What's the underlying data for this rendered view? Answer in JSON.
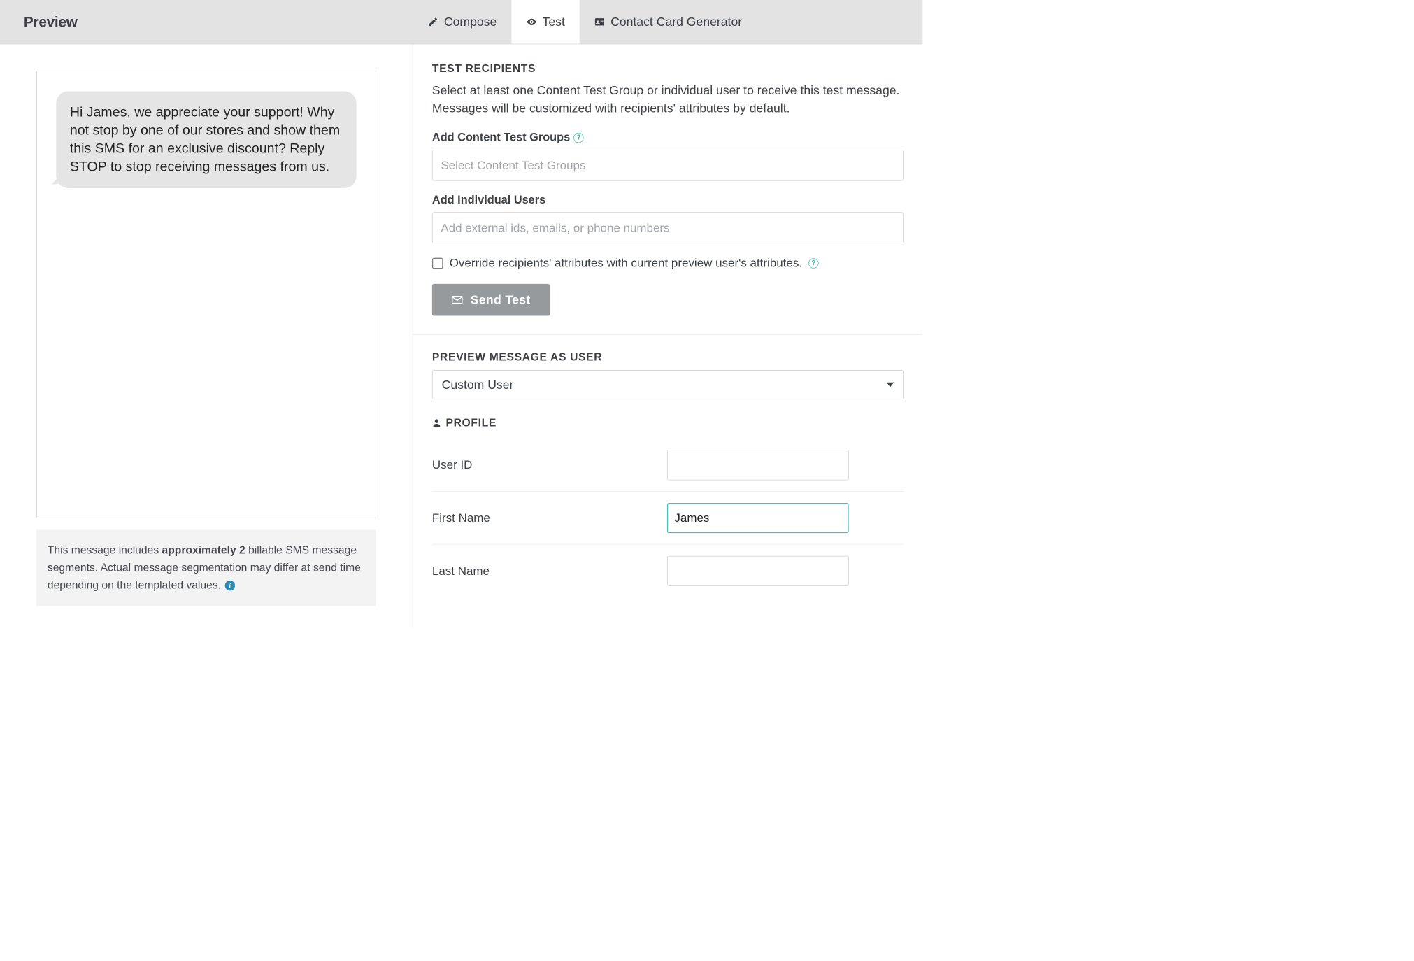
{
  "header": {
    "title": "Preview",
    "tabs": [
      {
        "label": "Compose"
      },
      {
        "label": "Test"
      },
      {
        "label": "Contact Card Generator"
      }
    ]
  },
  "preview": {
    "bubble_text": "Hi James, we appreciate your support! Why not stop by one of our stores and show them this SMS for an exclusive discount? Reply STOP to stop receiving messages from us.",
    "segment_note_pre": "This message includes ",
    "segment_note_bold": "approximately 2",
    "segment_note_post": " billable SMS message segments. Actual message segmentation may differ at send time depending on the templated values."
  },
  "test": {
    "section_title": "TEST RECIPIENTS",
    "section_desc": "Select at least one Content Test Group or individual user to receive this test message. Messages will be customized with recipients' attributes by default.",
    "groups_label": "Add Content Test Groups",
    "groups_placeholder": "Select Content Test Groups",
    "users_label": "Add Individual Users",
    "users_placeholder": "Add external ids, emails, or phone numbers",
    "override_label": "Override recipients' attributes with current preview user's attributes.",
    "send_button": "Send Test"
  },
  "preview_as": {
    "section_title": "PREVIEW MESSAGE AS USER",
    "selected": "Custom User",
    "profile_title": "PROFILE",
    "fields": {
      "user_id": {
        "label": "User ID",
        "value": ""
      },
      "first_name": {
        "label": "First Name",
        "value": "James"
      },
      "last_name": {
        "label": "Last Name",
        "value": ""
      }
    }
  }
}
